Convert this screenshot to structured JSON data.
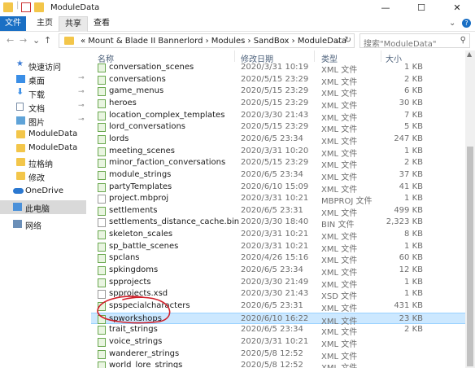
{
  "window": {
    "title": "ModuleData",
    "minimize_glyph": "—",
    "maximize_glyph": "☐",
    "close_glyph": "✕",
    "help_glyph": "?",
    "expand_ribbon_glyph": "⌄"
  },
  "ribbon": {
    "tabs": [
      {
        "label": "文件"
      },
      {
        "label": "主页"
      },
      {
        "label": "共享"
      },
      {
        "label": "查看"
      }
    ]
  },
  "address": {
    "back_glyph": "←",
    "forward_glyph": "→",
    "recent_glyph": "⌄",
    "up_glyph": "↑",
    "path": "«  Mount & Blade II Bannerlord  ›  Modules  ›  SandBox  ›  ModuleData",
    "dropdown_glyph": "⌄",
    "refresh_glyph": "↻",
    "search_placeholder": "搜索\"ModuleData\"",
    "search_glyph": "⚲"
  },
  "nav": {
    "items": [
      {
        "label": "快速访问",
        "icon": "star-icon",
        "pinned": false
      },
      {
        "label": "桌面",
        "icon": "desktop-icon",
        "pinned": true
      },
      {
        "label": "下载",
        "icon": "download-icon",
        "pinned": true
      },
      {
        "label": "文档",
        "icon": "document-icon",
        "pinned": true
      },
      {
        "label": "图片",
        "icon": "picture-icon",
        "pinned": true
      },
      {
        "label": "ModuleData",
        "icon": "folder-icon",
        "pinned": false
      },
      {
        "label": "ModuleData",
        "icon": "folder-icon",
        "pinned": false
      },
      {
        "label": "拉格纳",
        "icon": "folder-icon",
        "pinned": false
      },
      {
        "label": "修改",
        "icon": "folder-icon",
        "pinned": false
      },
      {
        "label": "OneDrive",
        "icon": "cloud-icon",
        "pinned": false
      },
      {
        "label": "此电脑",
        "icon": "computer-icon",
        "pinned": false
      },
      {
        "label": "网络",
        "icon": "network-icon",
        "pinned": false
      }
    ],
    "pin_glyph": "📌"
  },
  "list": {
    "headers": {
      "name": "名称",
      "date": "修改日期",
      "type": "类型",
      "size": "大小"
    },
    "rows": [
      {
        "name": "conversation_scenes",
        "date": "2020/3/31 10:19",
        "type": "XML 文件",
        "size": "1 KB",
        "icon": "xml"
      },
      {
        "name": "conversations",
        "date": "2020/5/15 23:29",
        "type": "XML 文件",
        "size": "2 KB",
        "icon": "xml"
      },
      {
        "name": "game_menus",
        "date": "2020/5/15 23:29",
        "type": "XML 文件",
        "size": "6 KB",
        "icon": "xml"
      },
      {
        "name": "heroes",
        "date": "2020/5/15 23:29",
        "type": "XML 文件",
        "size": "30 KB",
        "icon": "xml"
      },
      {
        "name": "location_complex_templates",
        "date": "2020/3/30 21:43",
        "type": "XML 文件",
        "size": "7 KB",
        "icon": "xml"
      },
      {
        "name": "lord_conversations",
        "date": "2020/5/15 23:29",
        "type": "XML 文件",
        "size": "5 KB",
        "icon": "xml"
      },
      {
        "name": "lords",
        "date": "2020/6/5 23:34",
        "type": "XML 文件",
        "size": "247 KB",
        "icon": "xml"
      },
      {
        "name": "meeting_scenes",
        "date": "2020/3/31 10:20",
        "type": "XML 文件",
        "size": "1 KB",
        "icon": "xml"
      },
      {
        "name": "minor_faction_conversations",
        "date": "2020/5/15 23:29",
        "type": "XML 文件",
        "size": "2 KB",
        "icon": "xml"
      },
      {
        "name": "module_strings",
        "date": "2020/6/5 23:34",
        "type": "XML 文件",
        "size": "37 KB",
        "icon": "xml"
      },
      {
        "name": "partyTemplates",
        "date": "2020/6/10 15:09",
        "type": "XML 文件",
        "size": "41 KB",
        "icon": "xml"
      },
      {
        "name": "project.mbproj",
        "date": "2020/3/31 10:21",
        "type": "MBPROJ 文件",
        "size": "1 KB",
        "icon": "generic"
      },
      {
        "name": "settlements",
        "date": "2020/6/5 23:31",
        "type": "XML 文件",
        "size": "499 KB",
        "icon": "xml"
      },
      {
        "name": "settlements_distance_cache.bin",
        "date": "2020/3/30 18:40",
        "type": "BIN 文件",
        "size": "2,323 KB",
        "icon": "generic"
      },
      {
        "name": "skeleton_scales",
        "date": "2020/3/31 10:21",
        "type": "XML 文件",
        "size": "8 KB",
        "icon": "xml"
      },
      {
        "name": "sp_battle_scenes",
        "date": "2020/3/31 10:21",
        "type": "XML 文件",
        "size": "1 KB",
        "icon": "xml"
      },
      {
        "name": "spclans",
        "date": "2020/4/26 15:16",
        "type": "XML 文件",
        "size": "60 KB",
        "icon": "xml"
      },
      {
        "name": "spkingdoms",
        "date": "2020/6/5 23:34",
        "type": "XML 文件",
        "size": "12 KB",
        "icon": "xml"
      },
      {
        "name": "spprojects",
        "date": "2020/3/30 21:49",
        "type": "XML 文件",
        "size": "1 KB",
        "icon": "xml"
      },
      {
        "name": "spprojects.xsd",
        "date": "2020/3/30 21:43",
        "type": "XSD 文件",
        "size": "1 KB",
        "icon": "generic"
      },
      {
        "name": "spspecialcharacters",
        "date": "2020/6/5 23:31",
        "type": "XML 文件",
        "size": "431 KB",
        "icon": "xml"
      },
      {
        "name": "spworkshops",
        "date": "2020/6/10 16:22",
        "type": "XML 文件",
        "size": "23 KB",
        "icon": "xml",
        "selected": true
      },
      {
        "name": "trait_strings",
        "date": "2020/6/5 23:34",
        "type": "XML 文件",
        "size": "2 KB",
        "icon": "xml"
      },
      {
        "name": "voice_strings",
        "date": "2020/3/31 10:21",
        "type": "XML 文件",
        "size": "",
        "icon": "xml"
      },
      {
        "name": "wanderer_strings",
        "date": "2020/5/8 12:52",
        "type": "XML 文件",
        "size": "",
        "icon": "xml"
      },
      {
        "name": "world_lore_strings",
        "date": "2020/5/8 12:52",
        "type": "XML 文件",
        "size": "",
        "icon": "xml"
      }
    ]
  },
  "colors": {
    "accent": "#1a6fc4",
    "selection": "#cce8ff",
    "annotation": "#d0202a"
  }
}
